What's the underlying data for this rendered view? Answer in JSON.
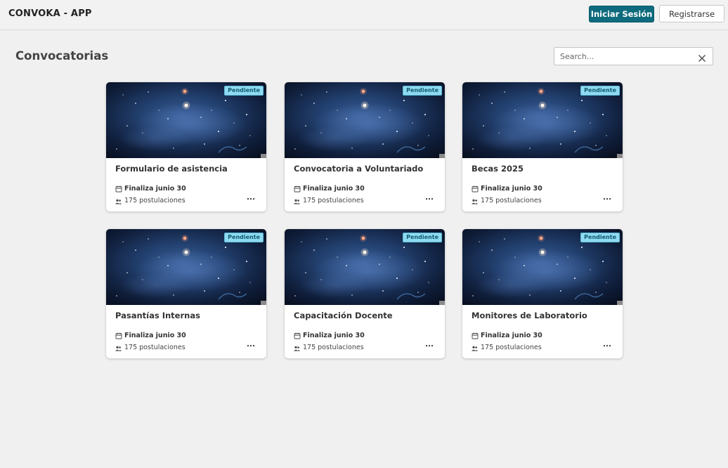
{
  "header": {
    "brand": "CONVOKA - APP",
    "login_label": "Iniciar Sesión",
    "register_label": "Registrarse"
  },
  "main": {
    "title": "Convocatorias",
    "search": {
      "placeholder": "Search...",
      "value": ""
    }
  },
  "cards": [
    {
      "title": "Formulario de asistencia",
      "status": "Pendiente",
      "deadline": "Finaliza junio 30",
      "applicants": "175 postulaciones"
    },
    {
      "title": "Convocatoria a Voluntariado",
      "status": "Pendiente",
      "deadline": "Finaliza junio 30",
      "applicants": "175 postulaciones"
    },
    {
      "title": "Becas 2025",
      "status": "Pendiente",
      "deadline": "Finaliza junio 30",
      "applicants": "175 postulaciones"
    },
    {
      "title": "Pasantías Internas",
      "status": "Pendiente",
      "deadline": "Finaliza junio 30",
      "applicants": "175 postulaciones"
    },
    {
      "title": "Capacitación Docente",
      "status": "Pendiente",
      "deadline": "Finaliza junio 30",
      "applicants": "175 postulaciones"
    },
    {
      "title": "Monitores de Laboratorio",
      "status": "Pendiente",
      "deadline": "Finaliza junio 30",
      "applicants": "175 postulaciones"
    }
  ],
  "icons": {
    "clear": "close-icon",
    "deadline": "calendar-icon",
    "applicants": "people-icon",
    "menu": "more-horizontal-icon"
  },
  "colors": {
    "primary": "#0e6b7d",
    "badge_bg": "#8fdaf0",
    "badge_text": "#0d5b70",
    "background": "#f0f0f0"
  }
}
